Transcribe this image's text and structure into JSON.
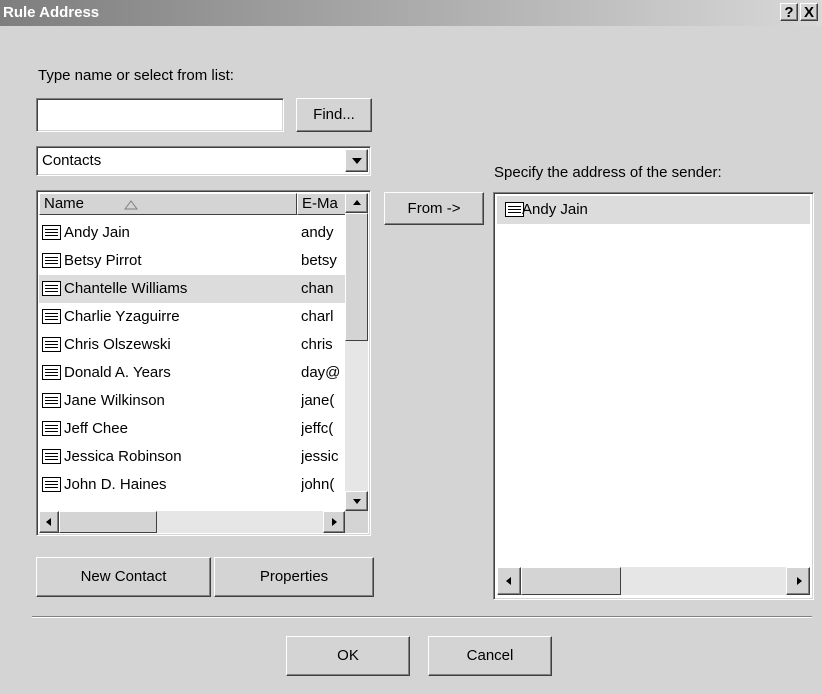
{
  "window": {
    "title": "Rule Address",
    "help_label": "?",
    "close_label": "X"
  },
  "search": {
    "prompt": "Type name or select from list:",
    "value": "",
    "find_label": "Find..."
  },
  "address_book": {
    "selected": "Contacts"
  },
  "contacts_list": {
    "columns": {
      "name": "Name",
      "email": "E-Ma"
    },
    "sorted_by": "name",
    "rows": [
      {
        "name": "Andy Jain",
        "email": "andy"
      },
      {
        "name": "Betsy Pirrot",
        "email": "betsy"
      },
      {
        "name": "Chantelle Williams",
        "email": "chan"
      },
      {
        "name": "Charlie Yzaguirre",
        "email": "charl"
      },
      {
        "name": "Chris Olszewski",
        "email": "chris"
      },
      {
        "name": "Donald A. Years",
        "email": "day@"
      },
      {
        "name": "Jane Wilkinson",
        "email": "jane("
      },
      {
        "name": "Jeff Chee",
        "email": "jeffc("
      },
      {
        "name": "Jessica Robinson",
        "email": "jessic"
      },
      {
        "name": "John D. Haines",
        "email": "john("
      }
    ],
    "selected_row": "Chantelle Williams"
  },
  "from_button_label": "From ->",
  "sender": {
    "label": "Specify the address of the sender:",
    "items": [
      {
        "name": "Andy Jain"
      }
    ]
  },
  "buttons": {
    "new_contact": "New Contact",
    "properties": "Properties",
    "ok": "OK",
    "cancel": "Cancel"
  },
  "icons": {
    "contact": "contact-card-icon",
    "sort": "sort-ascending-icon"
  }
}
